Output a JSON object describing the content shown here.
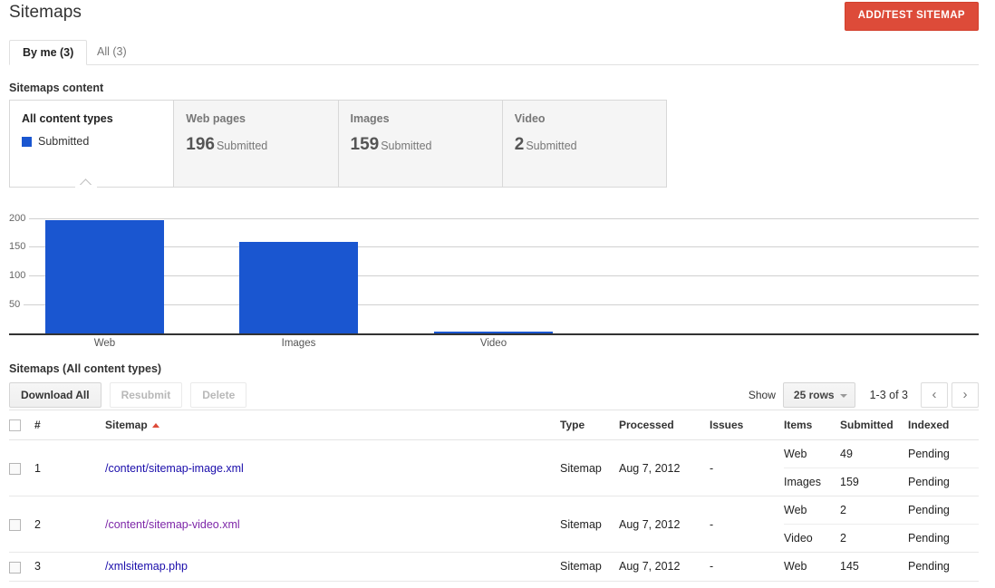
{
  "header": {
    "title": "Sitemaps",
    "primary_button": "ADD/TEST SITEMAP",
    "primary_button_color": "#dd4b39"
  },
  "tabs": [
    {
      "label": "By me (3)",
      "active": true
    },
    {
      "label": "All (3)",
      "active": false
    }
  ],
  "content_section": {
    "label": "Sitemaps content",
    "cards": [
      {
        "title": "All content types",
        "legend": "Submitted",
        "selected": true,
        "swatch_color": "#1a56d0"
      },
      {
        "title": "Web pages",
        "value": "196",
        "unit": "Submitted",
        "selected": false
      },
      {
        "title": "Images",
        "value": "159",
        "unit": "Submitted",
        "selected": false
      },
      {
        "title": "Video",
        "value": "2",
        "unit": "Submitted",
        "selected": false
      }
    ]
  },
  "chart_data": {
    "type": "bar",
    "title": "",
    "categories": [
      "Web",
      "Images",
      "Video"
    ],
    "values": [
      196,
      159,
      2
    ],
    "series": [
      {
        "name": "Submitted",
        "values": [
          196,
          159,
          2
        ],
        "color": "#1a56d0"
      }
    ],
    "xlabel": "",
    "ylabel": "",
    "ylim": [
      0,
      215
    ],
    "yticks": [
      50,
      100,
      150,
      200
    ],
    "ytick_labels": [
      "50",
      "100",
      "150",
      "200"
    ],
    "grid": true,
    "legend_position": "card"
  },
  "table_section": {
    "label": "Sitemaps (All content types)",
    "toolbar": {
      "download_all": "Download All",
      "resubmit": "Resubmit",
      "delete": "Delete"
    },
    "pager": {
      "show_label": "Show",
      "rows_value": "25 rows",
      "range": "1-3 of 3",
      "prev_icon": "‹",
      "next_icon": "›"
    },
    "columns": {
      "number": "#",
      "sitemap": "Sitemap",
      "type": "Type",
      "processed": "Processed",
      "issues": "Issues",
      "items": "Items",
      "submitted": "Submitted",
      "indexed": "Indexed"
    },
    "sorted_column": "Sitemap",
    "sort_direction": "asc",
    "rows": [
      {
        "num": "1",
        "sitemap": "/content/sitemap-image.xml",
        "visited": false,
        "type": "Sitemap",
        "processed": "Aug 7, 2012",
        "issues": "-",
        "details": [
          {
            "items": "Web",
            "submitted": "49",
            "indexed": "Pending"
          },
          {
            "items": "Images",
            "submitted": "159",
            "indexed": "Pending"
          }
        ]
      },
      {
        "num": "2",
        "sitemap": "/content/sitemap-video.xml",
        "visited": true,
        "type": "Sitemap",
        "processed": "Aug 7, 2012",
        "issues": "-",
        "details": [
          {
            "items": "Web",
            "submitted": "2",
            "indexed": "Pending"
          },
          {
            "items": "Video",
            "submitted": "2",
            "indexed": "Pending"
          }
        ]
      },
      {
        "num": "3",
        "sitemap": "/xmlsitemap.php",
        "visited": false,
        "type": "Sitemap",
        "processed": "Aug 7, 2012",
        "issues": "-",
        "details": [
          {
            "items": "Web",
            "submitted": "145",
            "indexed": "Pending"
          }
        ]
      }
    ]
  }
}
